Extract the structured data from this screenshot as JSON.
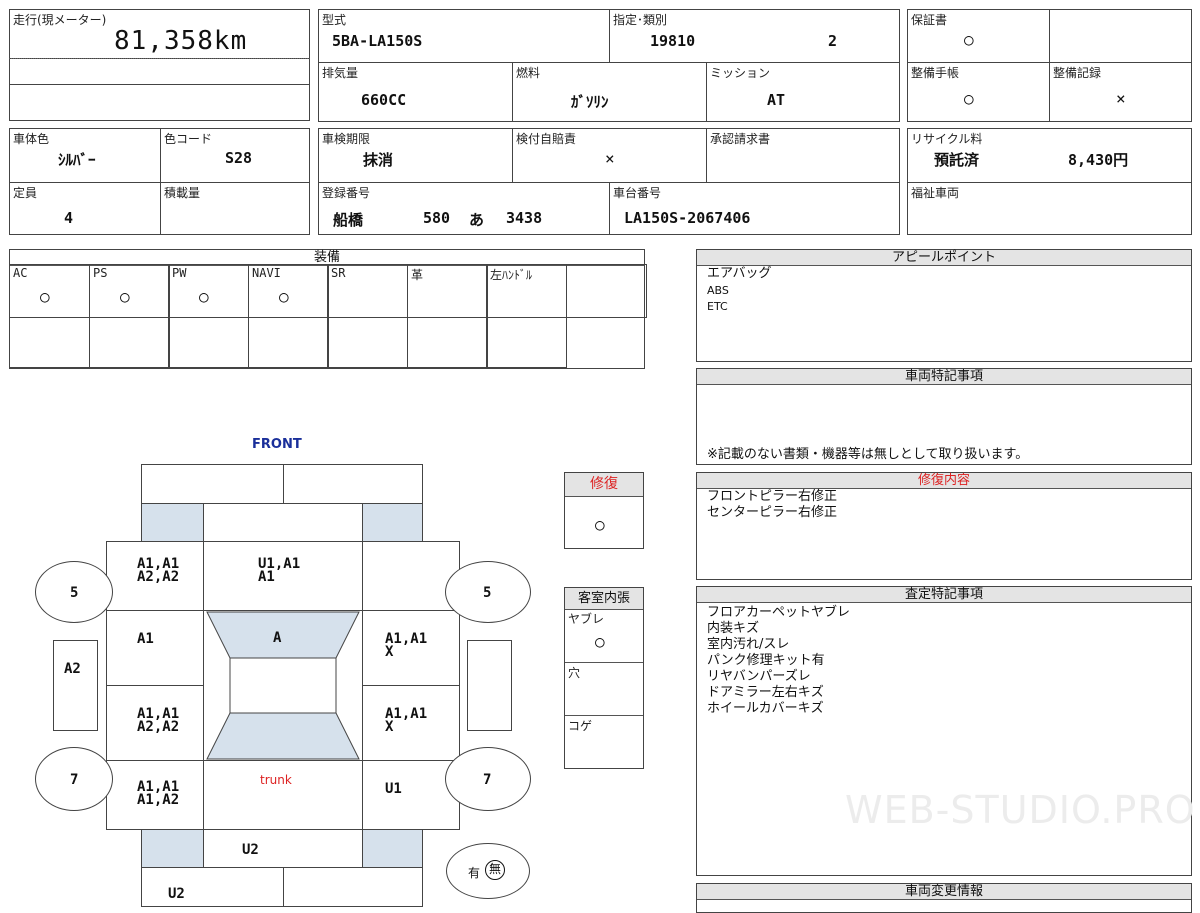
{
  "top_left": {
    "mileage_label": "走行(現メーター)",
    "mileage_value": "81,358km"
  },
  "model": {
    "type_label": "型式",
    "type_value": "5BA-LA150S",
    "designation_label": "指定･類別",
    "designation_value": "19810",
    "class_value": "2",
    "displacement_label": "排気量",
    "displacement_value": "660CC",
    "fuel_label": "燃料",
    "fuel_value": "ｶﾞｿﾘﾝ",
    "transmission_label": "ミッション",
    "transmission_value": "AT"
  },
  "records": {
    "warranty_label": "保証書",
    "warranty_mark": "○",
    "maintenance_book_label": "整備手帳",
    "maintenance_book_mark": "○",
    "maintenance_record_label": "整備記録",
    "maintenance_record_mark": "×"
  },
  "body": {
    "color_label": "車体色",
    "color_value": "ｼﾙﾊﾞｰ",
    "color_code_label": "色コード",
    "color_code_value": "S28",
    "capacity_label": "定員",
    "capacity_value": "4",
    "load_label": "積載量",
    "load_value": ""
  },
  "inspection": {
    "expiry_label": "車検期限",
    "expiry_value": "抹消",
    "insurance_label": "検付自賠責",
    "insurance_mark": "×",
    "approval_label": "承認請求書",
    "approval_value": "",
    "registration_label": "登録番号",
    "plate_region": "船橋",
    "plate_class": "580",
    "plate_kana": "あ",
    "plate_number": "3438",
    "chassis_label": "車台番号",
    "chassis_value": "LA150S-2067406"
  },
  "recycle": {
    "label": "リサイクル料",
    "status": "預託済",
    "amount": "8,430円",
    "welfare_label": "福祉車両",
    "welfare_value": ""
  },
  "equipment": {
    "title": "装備",
    "items": [
      {
        "label": "AC",
        "mark": "○"
      },
      {
        "label": "PS",
        "mark": "○"
      },
      {
        "label": "PW",
        "mark": "○"
      },
      {
        "label": "NAVI",
        "mark": "○"
      },
      {
        "label": "SR",
        "mark": ""
      },
      {
        "label": "革",
        "mark": ""
      },
      {
        "label": "左ﾊﾝﾄﾞﾙ",
        "mark": ""
      },
      {
        "label": "",
        "mark": ""
      }
    ]
  },
  "appeal": {
    "title": "アピールポイント",
    "line1": "エアバッグ",
    "line2": "ABS",
    "line3": "ETC"
  },
  "special_notes": {
    "title": "車両特記事項",
    "footer": "※記載のない書類・機器等は無しとして取り扱います。"
  },
  "repair_box": {
    "title": "修復",
    "mark": "○"
  },
  "repair_details": {
    "title": "修復内容",
    "line1": "フロントピラー右修正",
    "line2": "センターピラー右修正"
  },
  "interior_box": {
    "title": "客室内張",
    "tear_label": "ヤブレ",
    "tear_mark": "○",
    "hole_label": "穴",
    "burn_label": "コゲ"
  },
  "assessment": {
    "title": "査定特記事項",
    "line1": "フロアカーペットヤブレ",
    "line2": "内装キズ",
    "line3": "室内汚れ/スレ",
    "line4": "パンク修理キット有",
    "line5": "リヤバンパーズレ",
    "line6": "ドアミラー左右キズ",
    "line7": "ホイールカバーキズ"
  },
  "vehicle_changes": {
    "title": "車両変更情報"
  },
  "diagram": {
    "front_label": "FRONT",
    "trunk_label": "trunk",
    "front_left_fender": "A1,A1\nA2,A2",
    "hood": "U1,A1\nA1",
    "front_left_door": "A1",
    "roof": "A",
    "front_right_door": "A1,A1\nX",
    "rear_left_door": "A1,A1\nA2,A2",
    "rear_right_door": "A1,A1\nX",
    "rear_left_quarter": "A1,A1\nA1,A2",
    "rear_right_quarter": "U1",
    "rear_panel": "U2",
    "rear_bumper": "U2",
    "front_left_tire": "5",
    "front_right_tire": "5",
    "rear_left_tire": "7",
    "rear_right_tire": "7",
    "left_step": "A2",
    "spare_tire_label": "有",
    "spare_tire_selected": "無"
  },
  "watermark": "WEB-STUDIO.PRO",
  "colors": {
    "header_bg": "#e4e4e4",
    "accent_red": "#dd2222",
    "front_blue": "#1a2f9a",
    "glass_blue": "#d6e1ec"
  }
}
